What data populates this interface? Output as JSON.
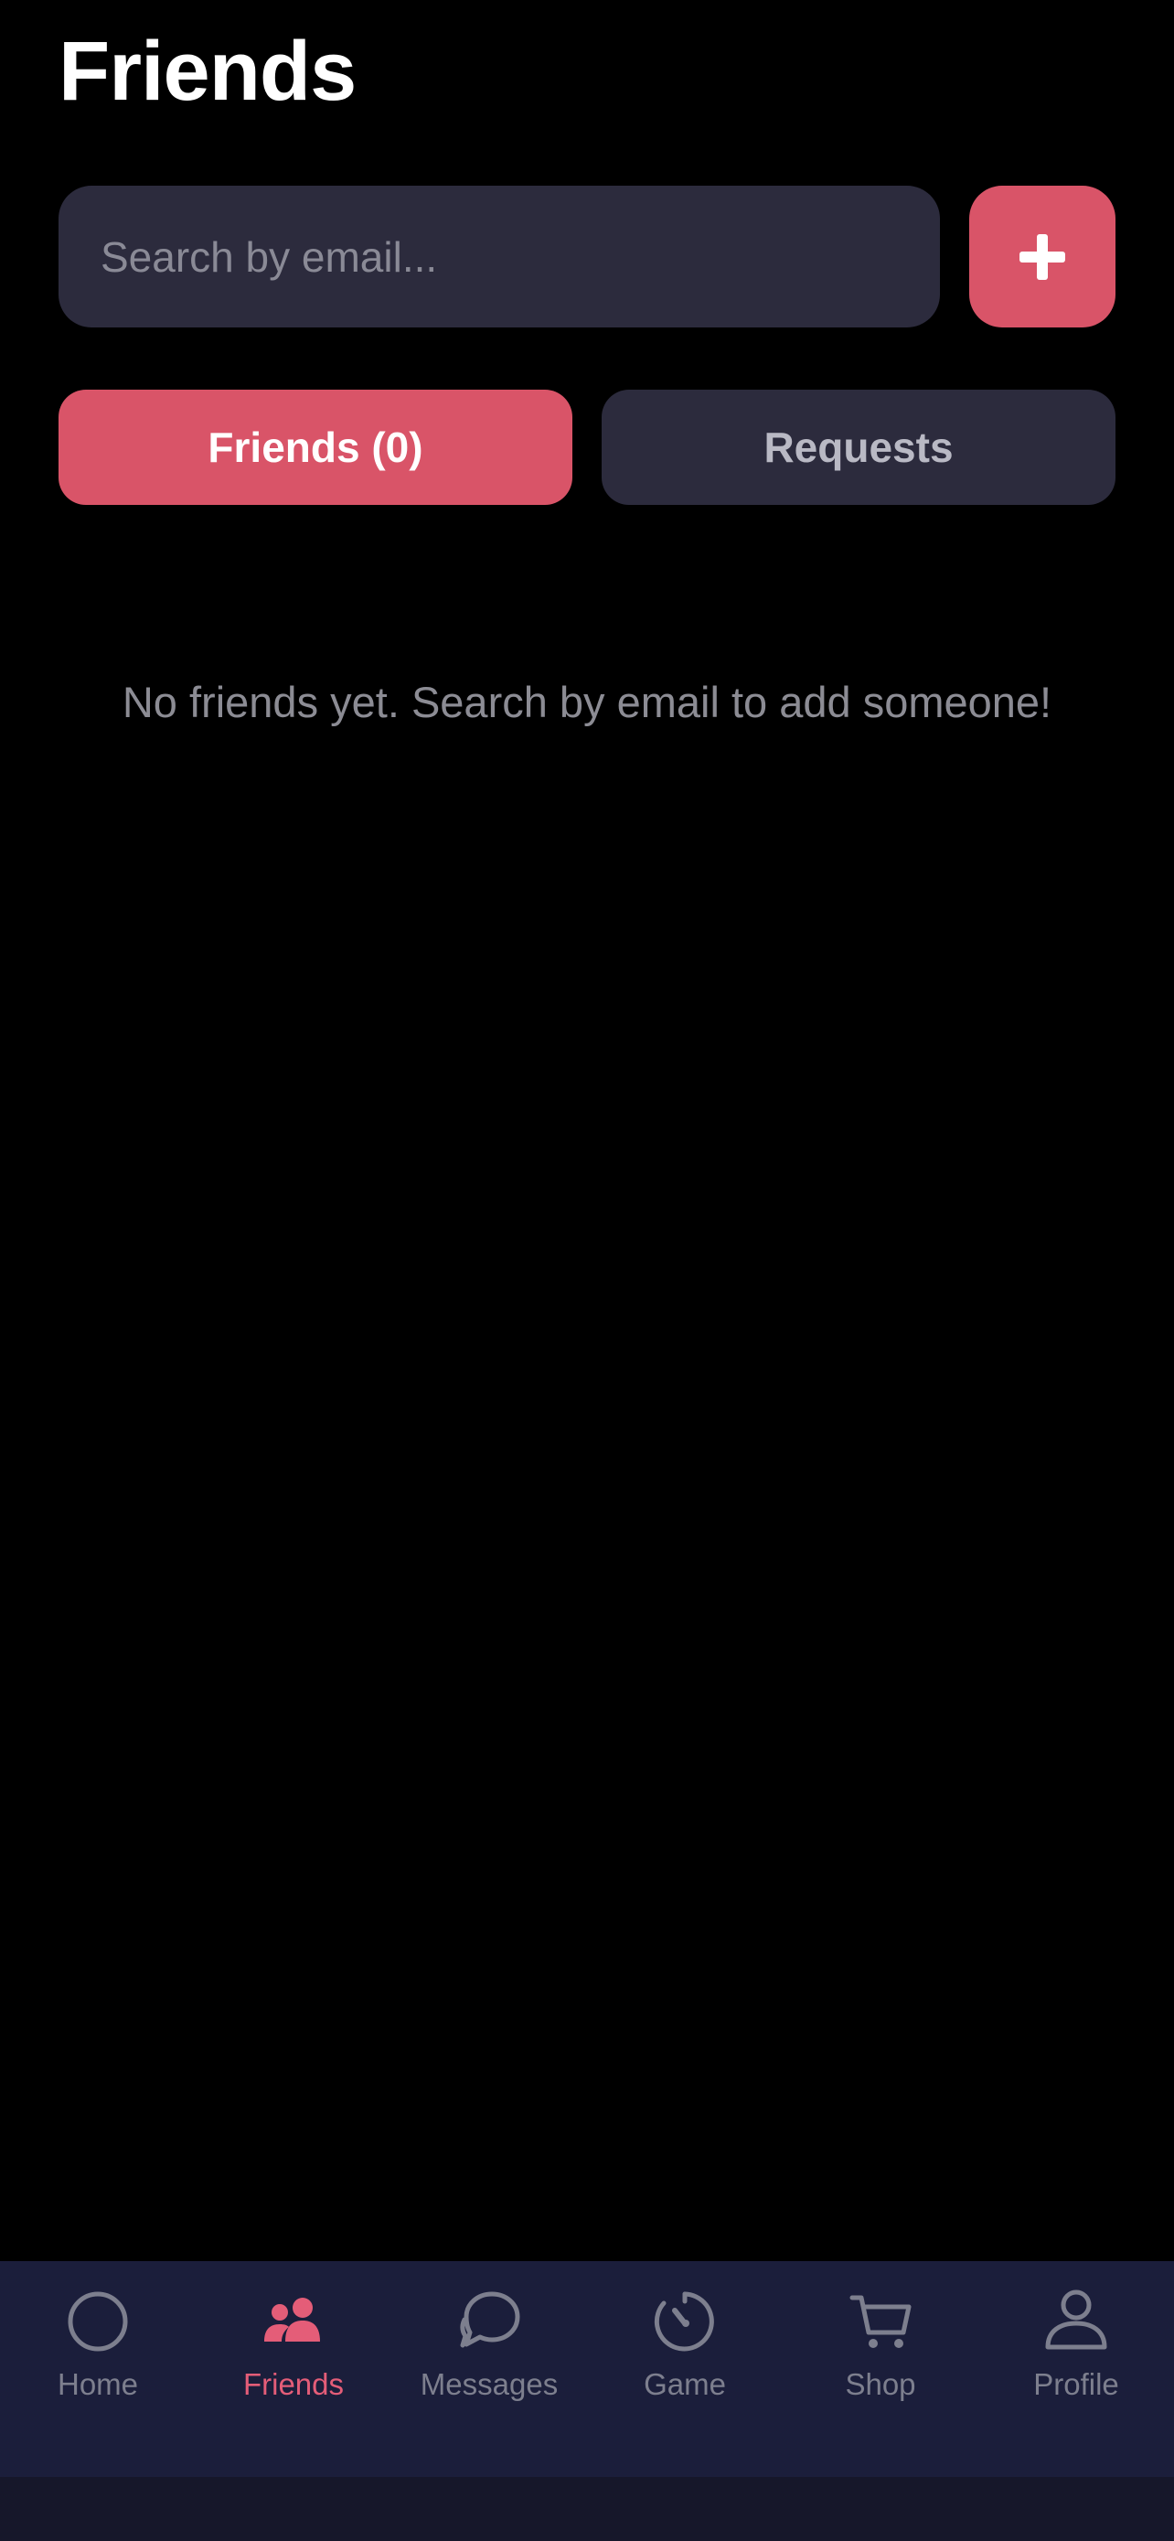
{
  "header": {
    "title": "Friends"
  },
  "search": {
    "placeholder": "Search by email...",
    "value": "",
    "add_icon": "plus-icon"
  },
  "tabs": [
    {
      "label": "Friends (0)",
      "active": true
    },
    {
      "label": "Requests",
      "active": false
    }
  ],
  "empty_state": {
    "message": "No friends yet. Search by email to add someone!"
  },
  "bottom_nav": {
    "items": [
      {
        "label": "Home",
        "icon": "home-icon",
        "active": false
      },
      {
        "label": "Friends",
        "icon": "friends-icon",
        "active": true
      },
      {
        "label": "Messages",
        "icon": "messages-icon",
        "active": false
      },
      {
        "label": "Game",
        "icon": "game-icon",
        "active": false
      },
      {
        "label": "Shop",
        "icon": "cart-icon",
        "active": false
      },
      {
        "label": "Profile",
        "icon": "profile-icon",
        "active": false
      }
    ]
  },
  "colors": {
    "background": "#000000",
    "accent": "#d95468",
    "surface": "#2c2b3d",
    "nav_background": "#1b1e3b",
    "nav_inactive": "#7d7f8e",
    "nav_active": "#e45d78"
  }
}
